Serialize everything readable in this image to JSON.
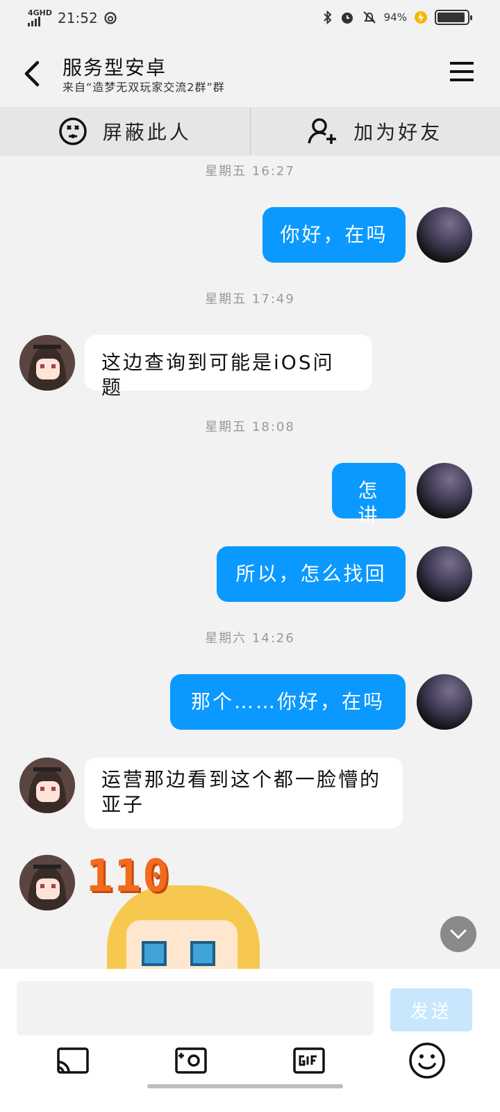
{
  "status_bar": {
    "network": "4GHD",
    "time": "21:52",
    "battery": "94%"
  },
  "header": {
    "title": "服务型安卓",
    "subtitle": "来自“造梦无双玩家交流2群”群"
  },
  "actions": {
    "block_label": "屏蔽此人",
    "add_friend_label": "加为好友"
  },
  "messages": {
    "ts1": "星期五 16:27",
    "m1": "你好，在吗",
    "ts2": "星期五 17:49",
    "m2": "这边查询到可能是iOS问题",
    "ts3": "星期五 18:08",
    "m3": "怎讲",
    "m4": "所以，怎么找回",
    "ts4": "星期六 14:26",
    "m5": "那个……你好，在吗",
    "m6": "运营那边看到这个都一脸懵的亚子",
    "sticker_text": "110"
  },
  "composer": {
    "input_value": "",
    "send_label": "发送"
  },
  "icons": [
    "back-icon",
    "menu-icon",
    "block-icon",
    "add-friend-icon",
    "chevron-down-icon",
    "screen-cast-icon",
    "camera-icon",
    "gif-icon",
    "emoji-icon"
  ],
  "colors": {
    "outgoing_bubble": "#0b99ff",
    "incoming_bubble": "#ffffff",
    "send_disabled": "#c8e7fd",
    "sticker_number": "#f26a1b"
  }
}
